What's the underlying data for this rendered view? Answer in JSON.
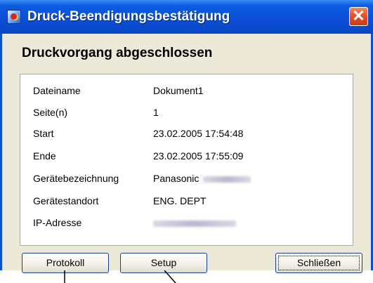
{
  "window": {
    "title": "Druck-Beendigungsbestätigung",
    "close_glyph": "✕",
    "app_icon": "printer-app-icon"
  },
  "heading": "Druckvorgang abgeschlossen",
  "details": [
    {
      "label": "Dateiname",
      "value": "Dokument1"
    },
    {
      "label": "Seite(n)",
      "value": "1"
    },
    {
      "label": "Start",
      "value": "23.02.2005 17:54:48"
    },
    {
      "label": "Ende",
      "value": "23.02.2005 17:55:09"
    },
    {
      "label": "Gerätebezeichnung",
      "value": "Panasonic"
    },
    {
      "label": "Gerätestandort",
      "value": "ENG. DEPT"
    },
    {
      "label": "IP-Adresse",
      "value": ""
    }
  ],
  "buttons": {
    "protokoll": "Protokoll",
    "setup": "Setup",
    "schliessen": "Schließen"
  },
  "colors": {
    "titlebar": "#0a4fd6",
    "close": "#e2542b",
    "dialog_bg": "#ece9d8"
  }
}
